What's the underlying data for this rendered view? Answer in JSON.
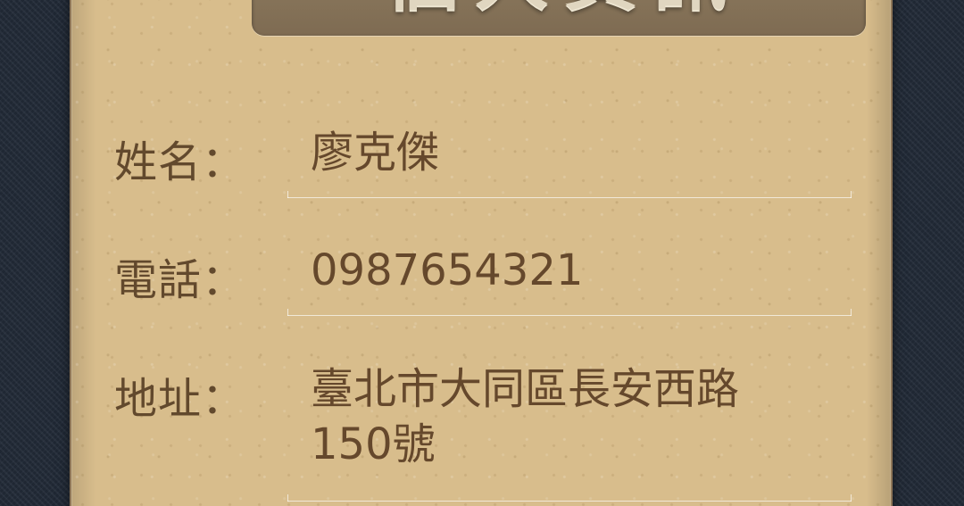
{
  "profile": {
    "title": "個人資訊",
    "fields": [
      {
        "label": "姓名：",
        "value": "廖克傑"
      },
      {
        "label": "電話：",
        "value": "0987654321"
      },
      {
        "label": "地址：",
        "value": "臺北市大同區長安西路150號"
      }
    ]
  }
}
